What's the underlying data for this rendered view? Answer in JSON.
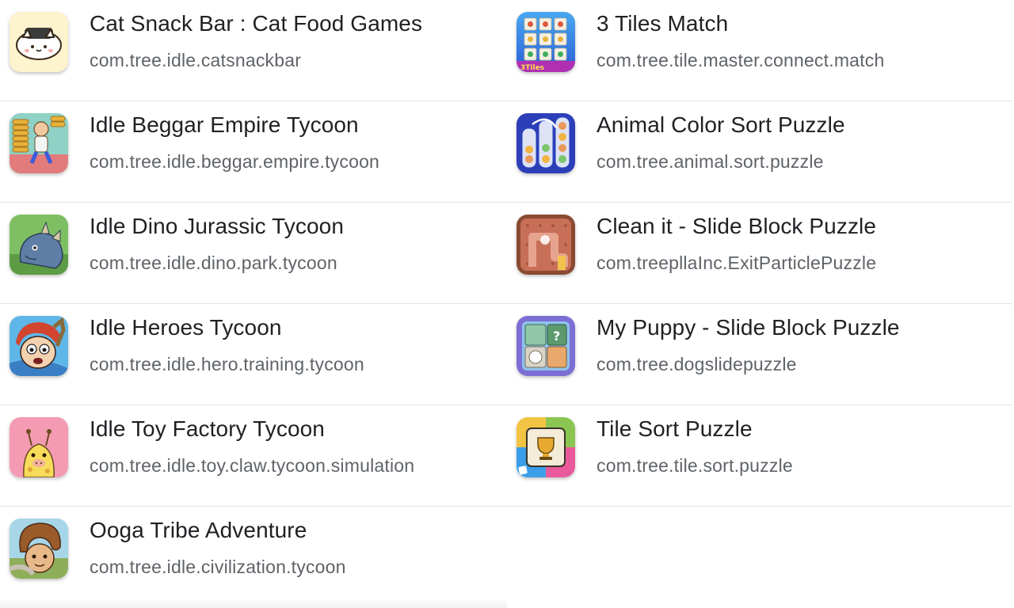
{
  "apps_left": [
    {
      "title": "Cat Snack Bar : Cat Food Games",
      "package": "com.tree.idle.catsnackbar",
      "icon": "cat-sushi-icon"
    },
    {
      "title": "Idle Beggar Empire Tycoon",
      "package": "com.tree.idle.beggar.empire.tycoon",
      "icon": "beggar-coins-icon"
    },
    {
      "title": "Idle Dino Jurassic Tycoon",
      "package": "com.tree.idle.dino.park.tycoon",
      "icon": "dinosaur-icon"
    },
    {
      "title": "Idle Heroes Tycoon",
      "package": "com.tree.idle.hero.training.tycoon",
      "icon": "hero-face-icon"
    },
    {
      "title": "Idle Toy Factory Tycoon",
      "package": "com.tree.idle.toy.claw.tycoon.simulation",
      "icon": "giraffe-toy-icon"
    },
    {
      "title": "Ooga Tribe Adventure",
      "package": "com.tree.idle.civilization.tycoon",
      "icon": "caveman-icon"
    }
  ],
  "apps_right": [
    {
      "title": "3 Tiles Match",
      "package": "com.tree.tile.master.connect.match",
      "icon": "tiles-grid-icon",
      "icon_text": "3Tiles"
    },
    {
      "title": "Animal Color Sort Puzzle",
      "package": "com.tree.animal.sort.puzzle",
      "icon": "sort-tubes-icon"
    },
    {
      "title": "Clean it - Slide Block Puzzle",
      "package": "com.treepllaInc.ExitParticlePuzzle",
      "icon": "maze-path-icon"
    },
    {
      "title": "My Puppy - Slide Block Puzzle",
      "package": "com.tree.dogslidepuzzle",
      "icon": "puppy-block-icon",
      "icon_text": "?"
    },
    {
      "title": "Tile Sort Puzzle",
      "package": "com.tree.tile.sort.puzzle",
      "icon": "trophy-tile-icon"
    }
  ]
}
